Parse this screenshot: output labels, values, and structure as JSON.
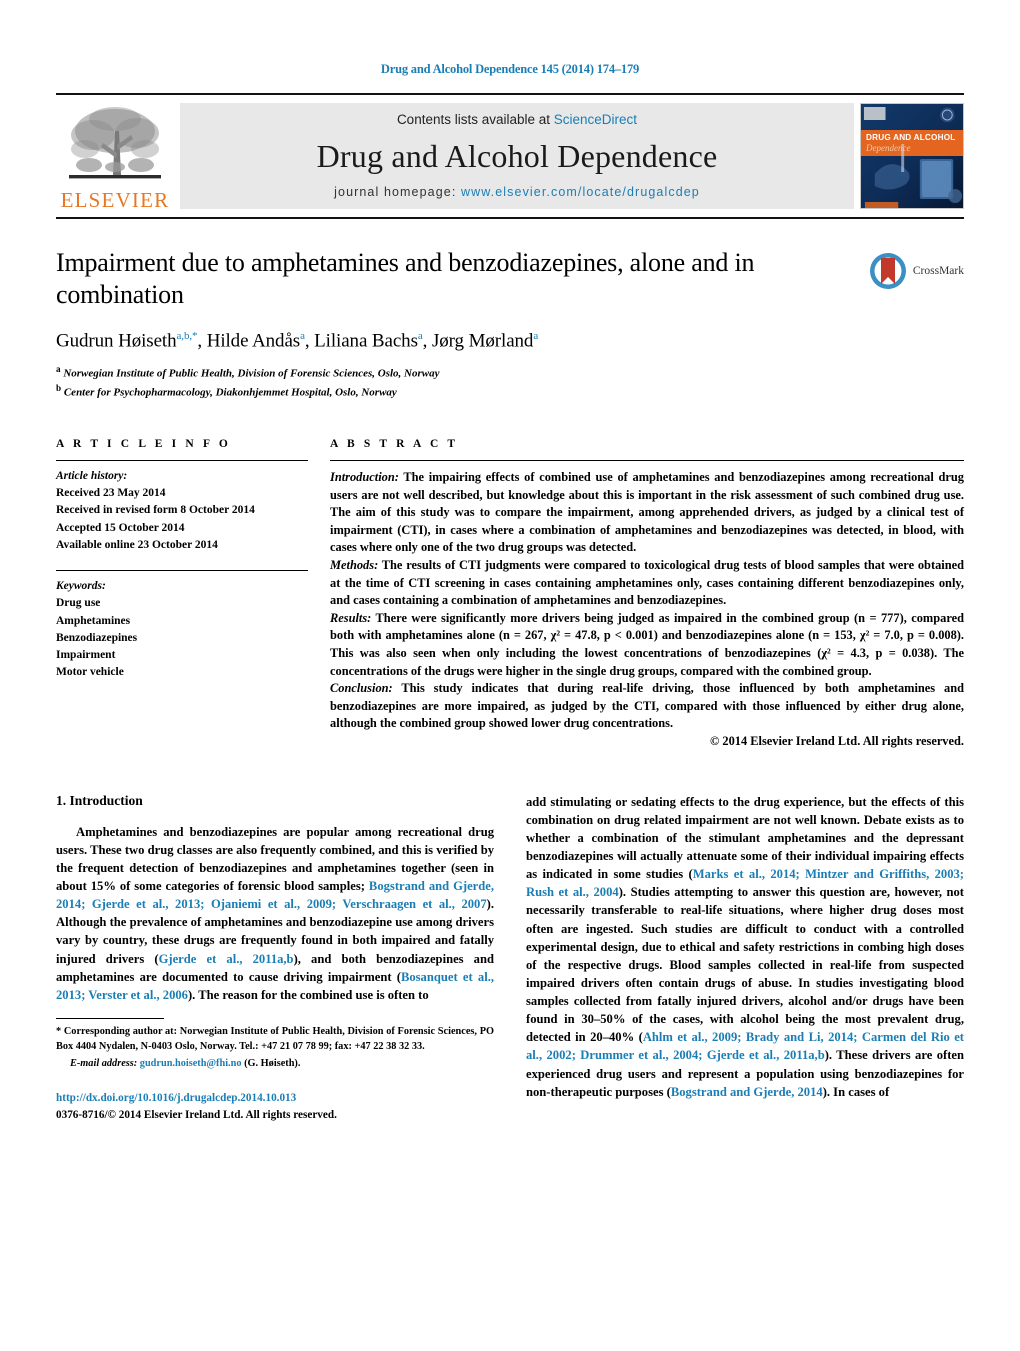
{
  "running_head": "Drug and Alcohol Dependence 145 (2014) 174–179",
  "masthead": {
    "elsevier_wordmark": "ELSEVIER",
    "contents_prefix": "Contents lists available at ",
    "sciencedirect": "ScienceDirect",
    "journal_title": "Drug and Alcohol Dependence",
    "homepage_prefix": "journal homepage: ",
    "homepage_url": "www.elsevier.com/locate/drugalcdep",
    "cover_line1": "DRUG AND ALCOHOL",
    "cover_line2": "Dependence",
    "link_color": "#1a7eb5",
    "elsevier_orange": "#E87722"
  },
  "article": {
    "title": "Impairment due to amphetamines and benzodiazepines, alone and in combination",
    "authors": "Gudrun Høiseth, Hilde Andås, Liliana Bachs, Jørg Mørland",
    "affiliation_a": "Norwegian Institute of Public Health, Division of Forensic Sciences, Oslo, Norway",
    "affiliation_b": "Center for Psychopharmacology, Diakonhjemmet Hospital, Oslo, Norway",
    "crossmark_label": "CrossMark"
  },
  "article_info": {
    "heading": "A R T I C L E   I N F O",
    "history_label": "Article history:",
    "history": [
      "Received 23 May 2014",
      "Received in revised form 8 October 2014",
      "Accepted 15 October 2014",
      "Available online 23 October 2014"
    ],
    "keywords_label": "Keywords:",
    "keywords": [
      "Drug use",
      "Amphetamines",
      "Benzodiazepines",
      "Impairment",
      "Motor vehicle"
    ]
  },
  "abstract": {
    "heading": "A B S T R A C T",
    "introduction_label": "Introduction:",
    "introduction_text": " The impairing effects of combined use of amphetamines and benzodiazepines among recreational drug users are not well described, but knowledge about this is important in the risk assessment of such combined drug use. The aim of this study was to compare the impairment, among apprehended drivers, as judged by a clinical test of impairment (CTI), in cases where a combination of amphetamines and benzodiazepines was detected, in blood, with cases where only one of the two drug groups was detected.",
    "methods_label": "Methods:",
    "methods_text": " The results of CTI judgments were compared to toxicological drug tests of blood samples that were obtained at the time of CTI screening in cases containing amphetamines only, cases containing different benzodiazepines only, and cases containing a combination of amphetamines and benzodiazepines.",
    "results_label": "Results:",
    "results_text": " There were significantly more drivers being judged as impaired in the combined group (n = 777), compared both with amphetamines alone (n = 267, χ² = 47.8, p < 0.001) and benzodiazepines alone (n = 153, χ² = 7.0, p = 0.008). This was also seen when only including the lowest concentrations of benzodiazepines (χ² = 4.3, p = 0.038). The concentrations of the drugs were higher in the single drug groups, compared with the combined group.",
    "conclusion_label": "Conclusion:",
    "conclusion_text": " This study indicates that during real-life driving, those influenced by both amphetamines and benzodiazepines are more impaired, as judged by the CTI, compared with those influenced by either drug alone, although the combined group showed lower drug concentrations.",
    "copyright": "© 2014 Elsevier Ireland Ltd. All rights reserved."
  },
  "introduction": {
    "heading": "1. Introduction",
    "para_left_1": "Amphetamines and benzodiazepines are popular among recreational drug users. These two drug classes are also frequently combined, and this is verified by the frequent detection of benzodiazepines and amphetamines together (seen in about 15% of some categories of forensic blood samples; ",
    "cite_left_1": "Bogstrand and Gjerde, 2014; Gjerde et al., 2013; Ojaniemi et al., 2009; Verschraagen et al., 2007",
    "para_left_2": "). Although the prevalence of amphetamines and benzodiazepine use among drivers vary by country, these drugs are frequently found in both impaired and fatally injured drivers (",
    "cite_left_2": "Gjerde et al., 2011a,b",
    "para_left_3": "), and both benzodiazepines and amphetamines are documented to cause driving impairment (",
    "cite_left_3": "Bosanquet et al., 2013; Verster et al., 2006",
    "para_left_4": "). The reason for the combined use is often to",
    "para_right_1": "add stimulating or sedating effects to the drug experience, but the effects of this combination on drug related impairment are not well known. Debate exists as to whether a combination of the stimulant amphetamines and the depressant benzodiazepines will actually attenuate some of their individual impairing effects as indicated in some studies (",
    "cite_right_1": "Marks et al., 2014; Mintzer and Griffiths, 2003; Rush et al., 2004",
    "para_right_2": "). Studies attempting to answer this question are, however, not necessarily transferable to real-life situations, where higher drug doses most often are ingested. Such studies are difficult to conduct with a controlled experimental design, due to ethical and safety restrictions in combing high doses of the respective drugs. Blood samples collected in real-life from suspected impaired drivers often contain drugs of abuse. In studies investigating blood samples collected from fatally injured drivers, alcohol and/or drugs have been found in 30–50% of the cases, with alcohol being the most prevalent drug, detected in 20–40% (",
    "cite_right_2": "Ahlm et al., 2009; Brady and Li, 2014; Carmen del Rio et al., 2002; Drummer et al., 2004; Gjerde et al., 2011a,b",
    "para_right_3": "). These drivers are often experienced drug users and represent a population using benzodiazepines for non-therapeutic purposes (",
    "cite_right_3": "Bogstrand and Gjerde, 2014",
    "para_right_4": "). In cases of"
  },
  "footer": {
    "corresponding_marker": "*",
    "corresponding_text": " Corresponding author at: Norwegian Institute of Public Health, Division of Forensic Sciences, PO Box 4404 Nydalen, N-0403 Oslo, Norway. Tel.: +47 21 07 78 99; fax: +47 22 38 32 33.",
    "email_label": "E-mail address:",
    "email": "gudrun.hoiseth@fhi.no",
    "email_suffix": " (G. Høiseth).",
    "doi": "http://dx.doi.org/10.1016/j.drugalcdep.2014.10.013",
    "issn_line": "0376-8716/© 2014 Elsevier Ireland Ltd. All rights reserved."
  }
}
